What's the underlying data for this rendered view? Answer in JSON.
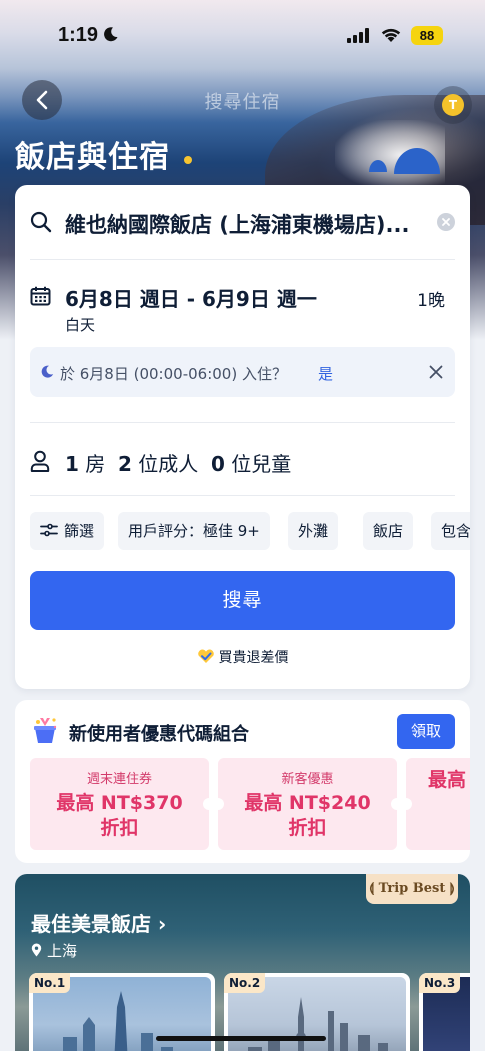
{
  "status_bar": {
    "time": "1:19",
    "battery": "88"
  },
  "nav": {
    "title": "搜尋住宿",
    "avatar_letter": "T"
  },
  "page_title": "飯店與住宿",
  "search": {
    "destination": "維也納國際飯店 (上海浦東機場店)...",
    "date_range": "6月8日 週日 - 6月9日 週一",
    "date_sub": "白天",
    "nights": "1晚",
    "notice_text": "於 6月8日 (00:00-06:00) 入住？",
    "notice_yes": "是",
    "guests": {
      "rooms": "1",
      "rooms_unit": "房",
      "adults": "2",
      "adults_unit": "位成人",
      "children": "0",
      "children_unit": "位兒童"
    },
    "chips": [
      "篩選",
      "用戶評分：極佳 9+",
      "外灘",
      "飯店",
      "包含早"
    ],
    "search_button": "搜尋",
    "refund_text": "買貴退差價"
  },
  "promo": {
    "title": "新使用者優惠代碼組合",
    "claim_button": "領取",
    "coupons": [
      {
        "label": "週末連住券",
        "amount": "最高 NT$370",
        "off": "折扣"
      },
      {
        "label": "新客優惠",
        "amount": "最高 NT$240",
        "off": "折扣"
      },
      {
        "label": "",
        "amount": "最高",
        "off": ""
      }
    ]
  },
  "scenic": {
    "title": "最佳美景飯店 ›",
    "location": "上海",
    "badge": "Trip Best",
    "hotels": [
      {
        "rank": "No.1"
      },
      {
        "rank": "No.2"
      },
      {
        "rank": "No.3"
      }
    ]
  },
  "colors": {
    "accent": "#3366f0",
    "coupon_text": "#e03568",
    "coupon_bg": "#fde8ef"
  }
}
